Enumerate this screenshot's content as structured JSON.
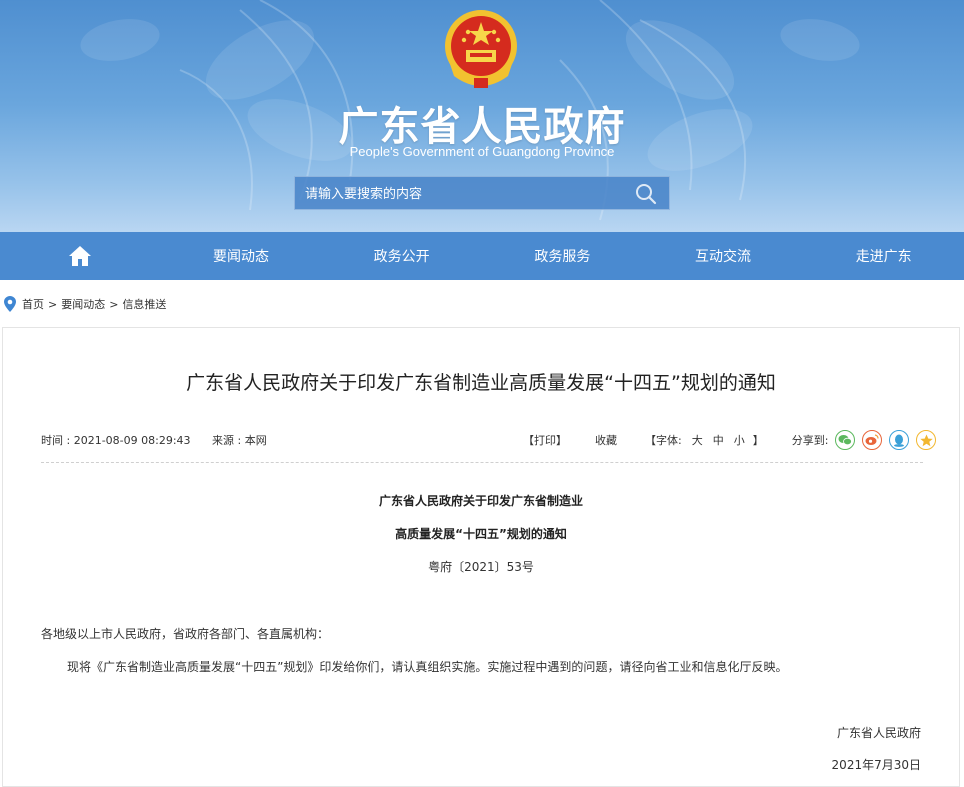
{
  "header": {
    "site_title": "广东省人民政府",
    "site_subtitle": "People's Government of Guangdong Province",
    "search_placeholder": "请输入要搜索的内容"
  },
  "nav": {
    "items": [
      {
        "label": "要闻动态"
      },
      {
        "label": "政务公开"
      },
      {
        "label": "政务服务"
      },
      {
        "label": "互动交流"
      },
      {
        "label": "走进广东"
      }
    ]
  },
  "breadcrumb": {
    "items": [
      "首页",
      "要闻动态",
      "信息推送"
    ],
    "separator": ">"
  },
  "article": {
    "title": "广东省人民政府关于印发广东省制造业高质量发展“十四五”规划的通知",
    "time": "时间 : 2021-08-09 08:29:43",
    "source": "来源 : 本网",
    "print_label": "【打印】",
    "favorite_label": "收藏",
    "font_prefix": "【字体:",
    "font_large": "大",
    "font_medium": "中",
    "font_small": "小",
    "font_suffix": "】",
    "share_label": "分享到:",
    "share_icons": [
      "wechat-icon",
      "weibo-icon",
      "qq-icon",
      "qzone-icon"
    ],
    "doc_heading_line1": "广东省人民政府关于印发广东省制造业",
    "doc_heading_line2": "高质量发展“十四五”规划的通知",
    "doc_number": "粤府〔2021〕53号",
    "salutation": "各地级以上市人民政府，省政府各部门、各直属机构：",
    "body": "现将《广东省制造业高质量发展“十四五”规划》印发给你们，请认真组织实施。实施过程中遇到的问题，请径向省工业和信息化厅反映。",
    "signature": "广东省人民政府",
    "date": "2021年7月30日"
  },
  "colors": {
    "nav_bg": "#4a8ad0",
    "banner_top": "#4f8fd0",
    "accent_wechat": "#5bb85d",
    "accent_weibo": "#e8653a",
    "accent_qq": "#3aa0d8",
    "accent_qzone": "#f2b72f"
  }
}
